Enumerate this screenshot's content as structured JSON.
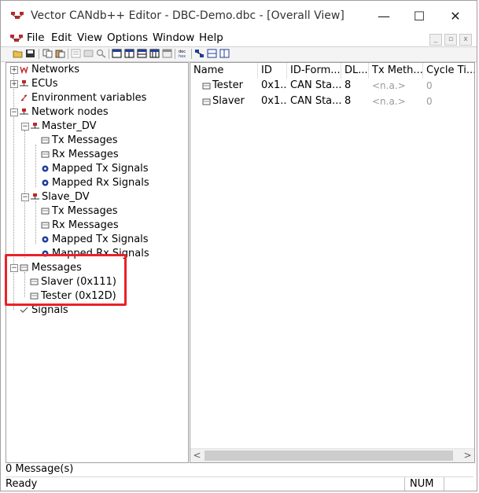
{
  "window": {
    "title": "Vector CANdb++ Editor - DBC-Demo.dbc - [Overall View]",
    "minimize": "—",
    "maximize": "☐",
    "close": "✕"
  },
  "menu": {
    "items": [
      "File",
      "Edit",
      "View",
      "Options",
      "Window",
      "Help"
    ],
    "mdi_buttons": [
      "_",
      "▫",
      "x"
    ]
  },
  "toolbar": {
    "icons": [
      "open-icon",
      "save-icon",
      "copy-icon",
      "paste-icon",
      "properties-icon",
      "cut-icon",
      "search-icon",
      "view1-icon",
      "view2-icon",
      "view3-icon",
      "view4-icon",
      "view5-icon",
      "dec-hex-icon",
      "layout1-icon",
      "layout2-icon",
      "layout3-icon"
    ],
    "dec_hex_label": "dec\nhex"
  },
  "tree": {
    "networks": "Networks",
    "ecus": "ECUs",
    "env_vars": "Environment variables",
    "network_nodes": "Network nodes",
    "master": "Master_DV",
    "master_children": [
      "Tx Messages",
      "Rx Messages",
      "Mapped Tx Signals",
      "Mapped Rx Signals"
    ],
    "slave": "Slave_DV",
    "slave_children": [
      "Tx Messages",
      "Rx Messages",
      "Mapped Tx Signals",
      "Mapped Rx Signals"
    ],
    "messages": "Messages",
    "message_children": [
      "Slaver (0x111)",
      "Tester (0x12D)"
    ],
    "signals": "Signals",
    "expand_plus": "+",
    "expand_minus": "−"
  },
  "list": {
    "columns": [
      "Name",
      "ID",
      "ID-Form...",
      "DL...",
      "Tx Meth...",
      "Cycle Ti..."
    ],
    "rows": [
      [
        "Tester",
        "0x1...",
        "CAN Sta...",
        "8",
        "<n.a.>",
        "0"
      ],
      [
        "Slaver",
        "0x1...",
        "CAN Sta...",
        "8",
        "<n.a.>",
        "0"
      ]
    ],
    "scroll_left": "<",
    "scroll_right": ">"
  },
  "info": {
    "message_count": "0 Message(s)"
  },
  "status": {
    "text": "Ready",
    "num": "NUM"
  },
  "colors": {
    "highlight": "#e8222a",
    "icon_red": "#c0262c"
  }
}
